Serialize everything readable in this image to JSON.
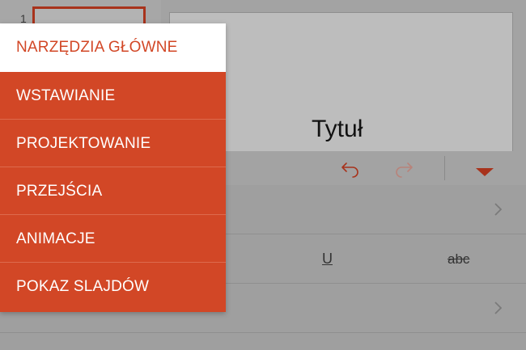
{
  "slides": {
    "number": "1"
  },
  "slide": {
    "title": "Tytuł"
  },
  "ribbon_menu": {
    "items": [
      {
        "label": "NARZĘDZIA GŁÓWNE",
        "active": true
      },
      {
        "label": "WSTAWIANIE",
        "active": false
      },
      {
        "label": "PROJEKTOWANIE",
        "active": false
      },
      {
        "label": "PRZEJŚCIA",
        "active": false
      },
      {
        "label": "ANIMACJE",
        "active": false
      },
      {
        "label": "POKAZ SLAJDÓW",
        "active": false
      }
    ]
  },
  "toolbar": {
    "undo_icon": "undo-icon",
    "redo_icon": "redo-icon",
    "collapse_icon": "caret-down-icon"
  },
  "format_panel": {
    "underline_label": "U",
    "strikethrough_label": "abc"
  },
  "colors": {
    "accent": "#d24726",
    "menu_active_bg": "#ffffff"
  }
}
